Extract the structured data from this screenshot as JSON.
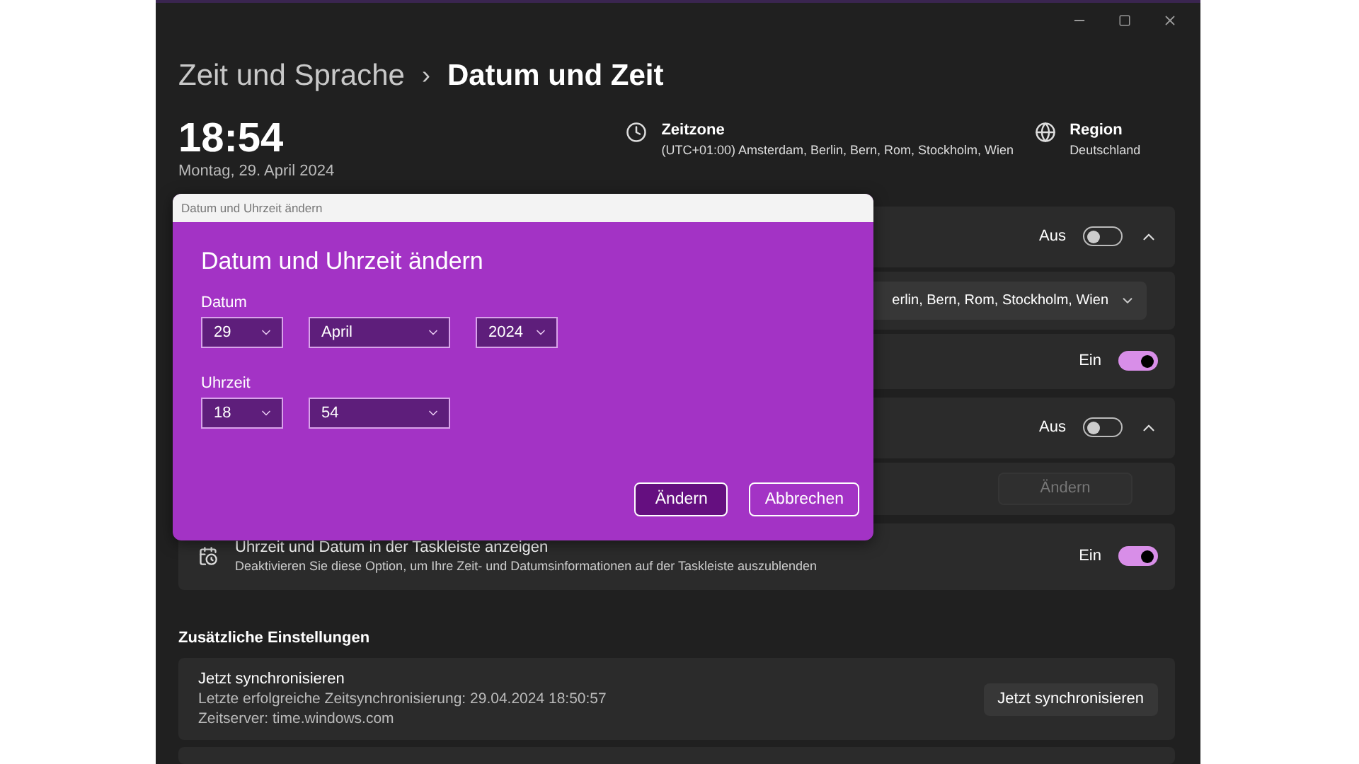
{
  "breadcrumb": {
    "parent": "Zeit und Sprache",
    "separator": "›",
    "current": "Datum und Zeit"
  },
  "clock": {
    "time": "18:54",
    "date": "Montag, 29. April 2024"
  },
  "info": [
    {
      "kind": "timezone",
      "title": "Zeitzone",
      "value": "(UTC+01:00) Amsterdam, Berlin, Bern, Rom, Stockholm, Wien"
    },
    {
      "kind": "region",
      "title": "Region",
      "value": "Deutschland"
    }
  ],
  "settings": [
    {
      "rows": [
        {
          "kind": "toggle",
          "label": "Aus",
          "on": false,
          "expanded": true
        },
        {
          "kind": "dropdown",
          "value": "erlin, Bern, Rom, Stockholm, Wien"
        },
        {
          "kind": "toggle",
          "label": "Ein",
          "on": true
        }
      ]
    },
    {
      "rows": [
        {
          "kind": "toggle",
          "label": "Aus",
          "on": false,
          "expanded": true
        },
        {
          "kind": "button",
          "label": "Ändern",
          "disabled": true
        }
      ]
    },
    {
      "rows": [
        {
          "kind": "toggle",
          "title": "Uhrzeit und Datum in der Taskleiste anzeigen",
          "description": "Deaktivieren Sie diese Option, um Ihre Zeit- und Datumsinformationen auf der Taskleiste auszublenden",
          "label": "Ein",
          "on": true
        }
      ]
    }
  ],
  "additional": {
    "heading": "Zusätzliche Einstellungen",
    "cards": [
      {
        "title": "Jetzt synchronisieren",
        "lines": [
          "Letzte erfolgreiche Zeitsynchronisierung: 29.04.2024 18:50:57",
          "Zeitserver: time.windows.com"
        ],
        "button": "Jetzt synchronisieren"
      }
    ]
  },
  "dialog": {
    "window_title": "Datum und Uhrzeit ändern",
    "heading": "Datum und Uhrzeit ändern",
    "groups": [
      {
        "label": "Datum",
        "fields": [
          "29",
          "April",
          "2024"
        ]
      },
      {
        "label": "Uhrzeit",
        "fields": [
          "18",
          "54"
        ]
      }
    ],
    "buttons": [
      {
        "label": "Ändern",
        "primary": true
      },
      {
        "label": "Abbrechen",
        "primary": false
      }
    ]
  }
}
